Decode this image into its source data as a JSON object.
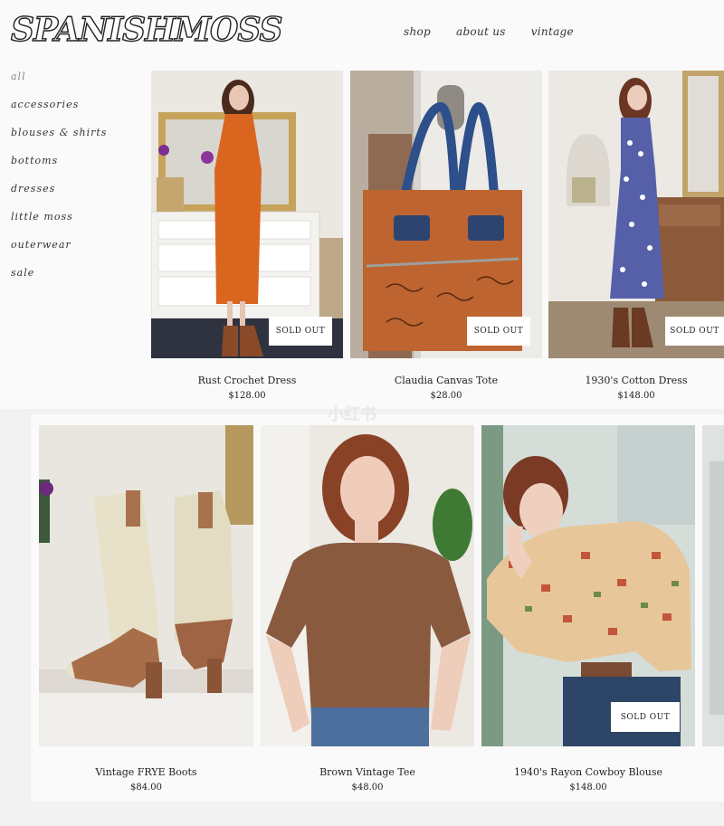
{
  "header": {
    "logo": "SPANISHMOSS",
    "nav": [
      "shop",
      "about us",
      "vintage"
    ]
  },
  "sidebar": {
    "items": [
      "all",
      "accessories",
      "blouses & shirts",
      "bottoms",
      "dresses",
      "little moss",
      "outerwear",
      "sale"
    ]
  },
  "products": [
    {
      "name": "Rust Crochet Dress",
      "price": "$128.00",
      "badge": "SOLD OUT"
    },
    {
      "name": "Claudia Canvas Tote",
      "price": "$28.00",
      "badge": "SOLD OUT"
    },
    {
      "name": "1930's Cotton Dress",
      "price": "$148.00",
      "badge": "SOLD OUT"
    },
    {
      "name": "Vintage FRYE Boots",
      "price": "$84.00"
    },
    {
      "name": "Brown Vintage Tee",
      "price": "$48.00"
    },
    {
      "name": "1940's Rayon Cowboy Blouse",
      "price": "$148.00",
      "badge": "SOLD OUT"
    }
  ],
  "watermark": "小红书",
  "colors": {
    "accent": "#b5612a",
    "background": "#fafafa",
    "text": "#222222"
  }
}
